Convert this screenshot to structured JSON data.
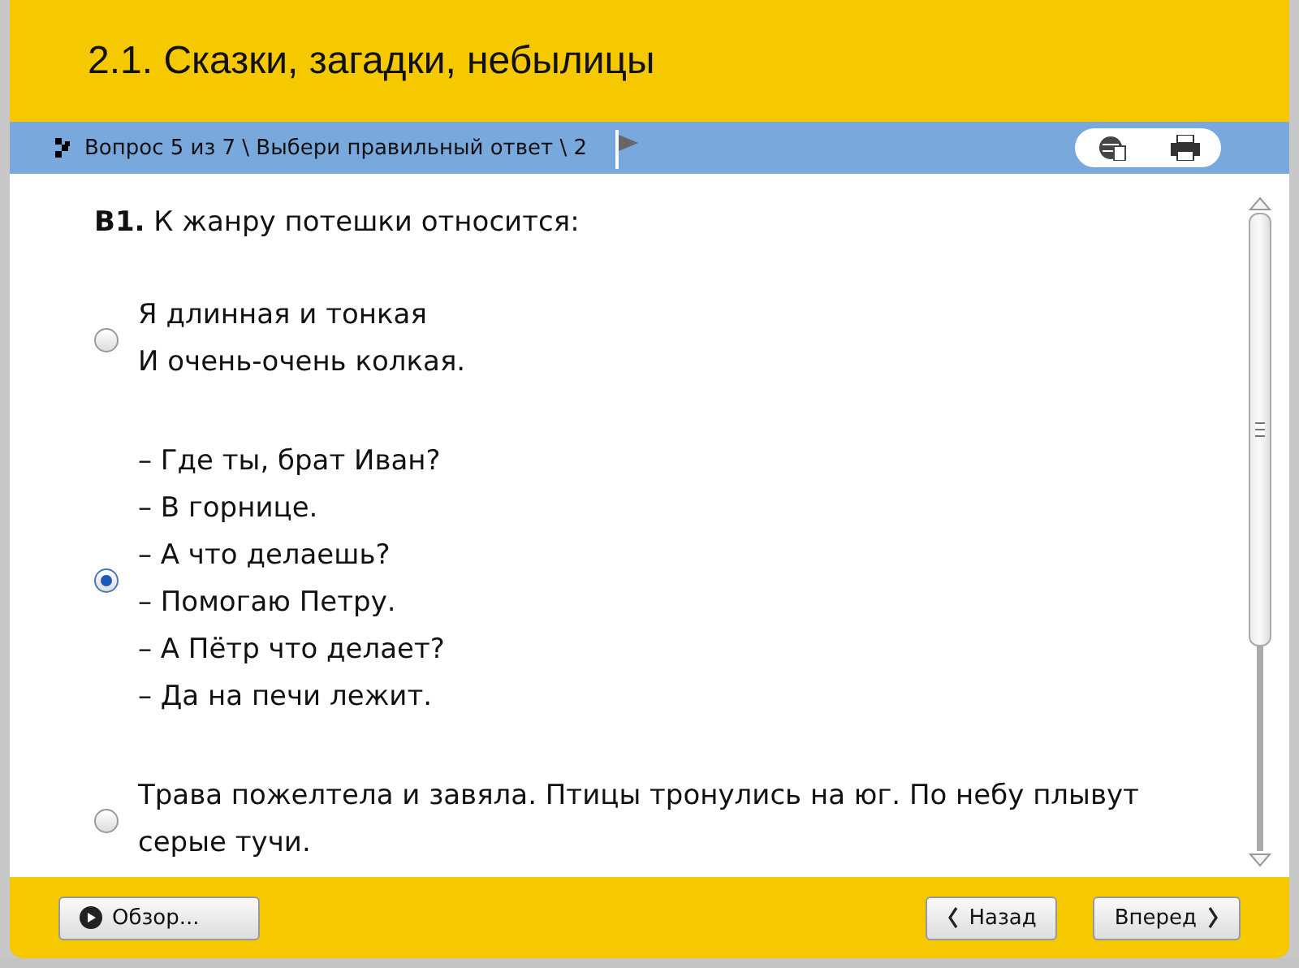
{
  "title": "2.1. Сказки, загадки, небылицы",
  "breadcrumb": "Вопрос 5 из 7 \\ Выбери правильный ответ \\ 2",
  "question": "**В1.** К жанру потешки относится:",
  "options": [
    {
      "lines": [
        "Я длинная и тонкая",
        "И очень-очень колкая."
      ],
      "selected": false
    },
    {
      "lines": [
        "– Где ты, брат Иван?",
        "– В горнице.",
        "– А что делаешь?",
        "– Помогаю Петру.",
        "– А Пётр что делает?",
        "– Да на печи лежит."
      ],
      "selected": true
    },
    {
      "lines": [
        "Трава пожелтела и завяла. Птицы тронулись на юг. По небу плывут серые тучи."
      ],
      "selected": false
    }
  ],
  "buttons": {
    "overview": "Обзор...",
    "back": "Назад",
    "forward": "Вперед"
  }
}
